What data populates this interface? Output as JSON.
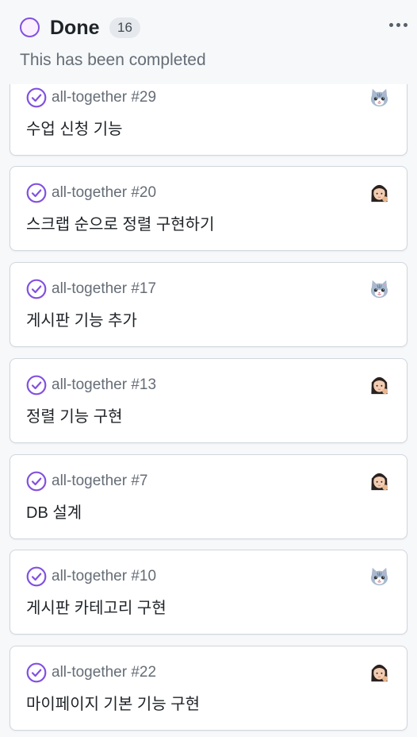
{
  "column": {
    "title": "Done",
    "count": "16",
    "description": "This has been completed",
    "accent_color": "#8250df"
  },
  "cards": [
    {
      "ref": "all-together #29",
      "title": "수업 신청 기능",
      "assignee_avatar": "cat-avatar"
    },
    {
      "ref": "all-together #20",
      "title": "스크랩 순으로 정렬 구현하기",
      "assignee_avatar": "girl-avatar"
    },
    {
      "ref": "all-together #17",
      "title": "게시판 기능 추가",
      "assignee_avatar": "cat-avatar"
    },
    {
      "ref": "all-together #13",
      "title": "정렬 기능 구현",
      "assignee_avatar": "girl-avatar"
    },
    {
      "ref": "all-together #7",
      "title": "DB 설계",
      "assignee_avatar": "girl-avatar"
    },
    {
      "ref": "all-together #10",
      "title": "게시판 카테고리 구현",
      "assignee_avatar": "cat-avatar"
    },
    {
      "ref": "all-together #22",
      "title": "마이페이지 기본 기능 구현",
      "assignee_avatar": "girl-avatar"
    }
  ]
}
